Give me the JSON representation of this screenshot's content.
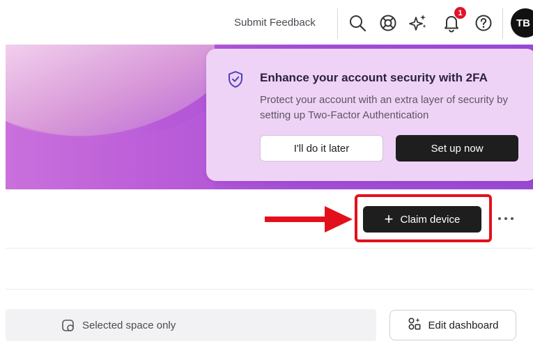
{
  "header": {
    "feedback_label": "Submit Feedback",
    "notification_count": "1",
    "avatar_initials": "TB",
    "icons": [
      "search-icon",
      "support-icon",
      "sparkle-icon",
      "bell-icon",
      "help-icon"
    ]
  },
  "security_card": {
    "title": "Enhance your account security with 2FA",
    "description": "Protect your account with an extra layer of security by setting up Two-Factor Authentication",
    "later_label": "I'll do it later",
    "setup_label": "Set up now",
    "icon": "shield-check-icon"
  },
  "actions": {
    "claim_label": "Claim device",
    "more_icon": "more-horizontal-icon"
  },
  "filter": {
    "selected_space_label": "Selected space only",
    "edit_label": "Edit dashboard"
  },
  "colors": {
    "accent_dark": "#1e1e1e",
    "banner_purple": "#a44fd6",
    "card_bg": "#eed3f6",
    "highlight_red": "#e3101c",
    "badge_red": "#e0142b"
  }
}
